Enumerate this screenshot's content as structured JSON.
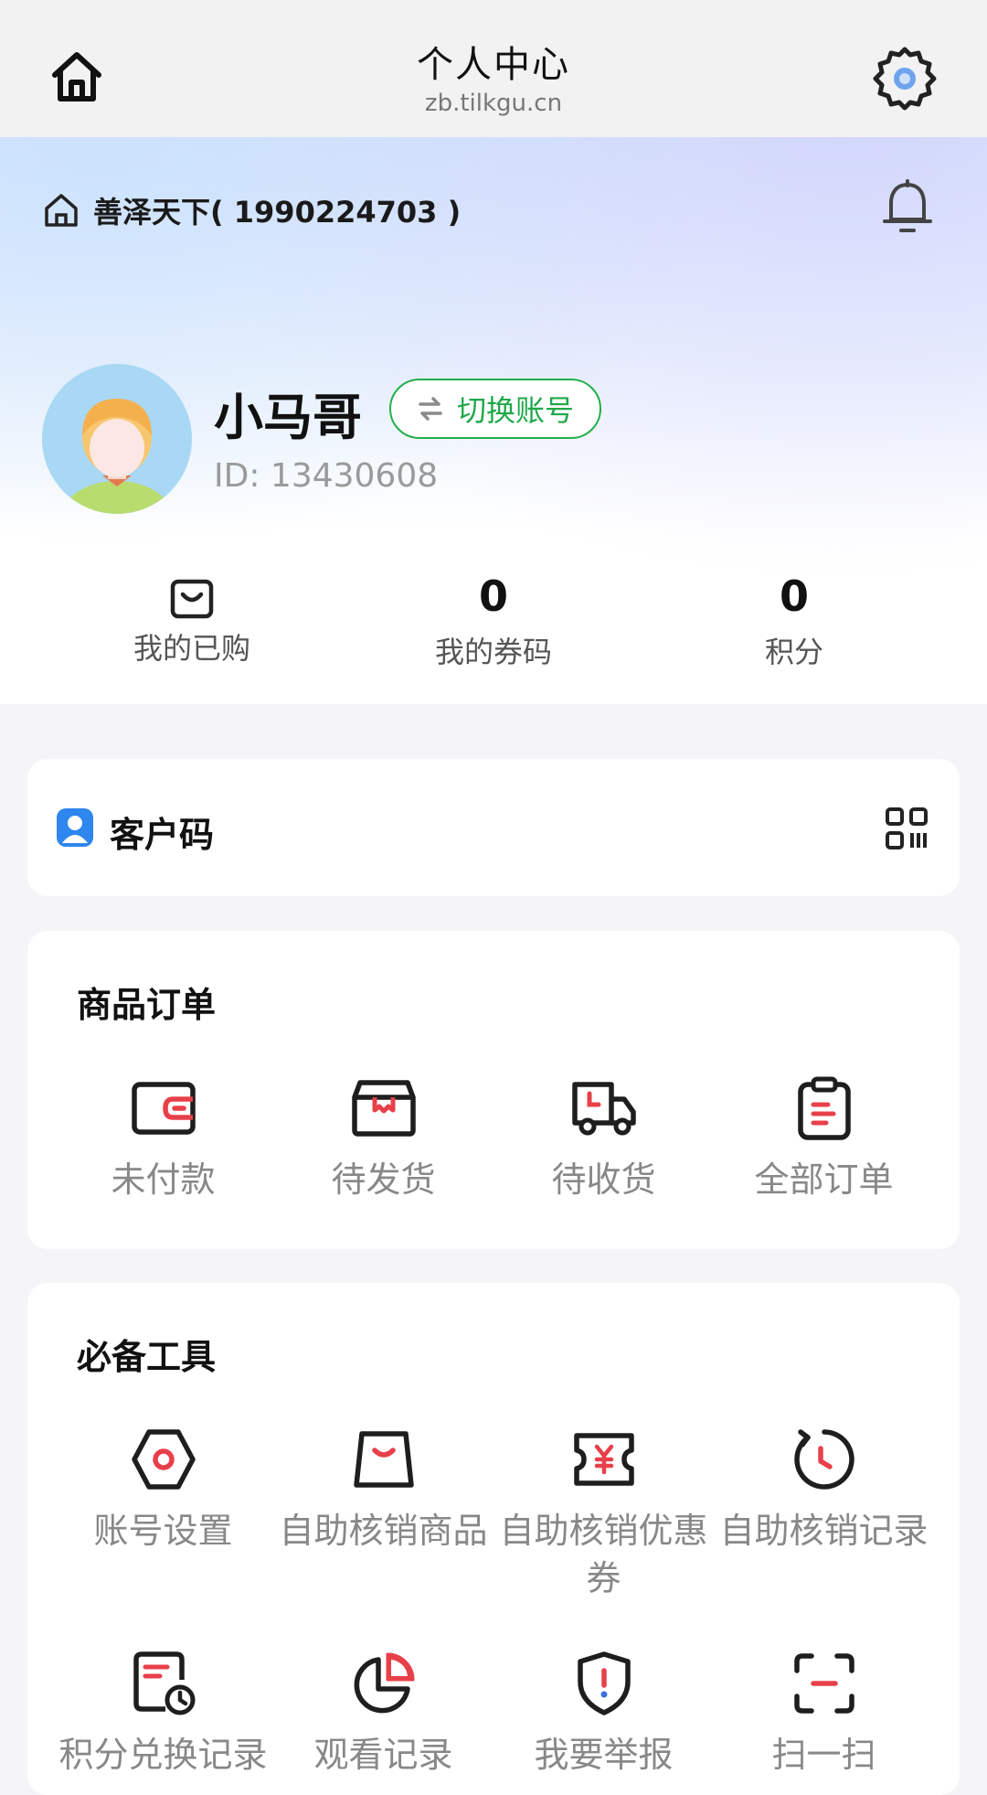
{
  "topbar": {
    "title": "个人中心",
    "url": "zb.tilkgu.cn",
    "home_icon": "home-icon",
    "settings_icon": "gear-icon"
  },
  "shop": {
    "name": "善泽天下( 1990224703 )",
    "icon": "home-outline-icon",
    "bell_icon": "bell-icon"
  },
  "user": {
    "name": "小马哥",
    "switch_label": "切换账号",
    "id_text": "ID: 13430608"
  },
  "stats": [
    {
      "icon": "bag-icon",
      "label": "我的已购"
    },
    {
      "value": "0",
      "label": "我的券码"
    },
    {
      "value": "0",
      "label": "积分"
    }
  ],
  "customer_code": {
    "label": "客户码",
    "icon": "user-badge-icon",
    "qr_icon": "qr-code-icon"
  },
  "orders": {
    "title": "商品订单",
    "items": [
      {
        "label": "未付款",
        "icon": "wallet-icon"
      },
      {
        "label": "待发货",
        "icon": "package-icon"
      },
      {
        "label": "待收货",
        "icon": "truck-icon"
      },
      {
        "label": "全部订单",
        "icon": "clipboard-icon"
      }
    ]
  },
  "tools": {
    "title": "必备工具",
    "items": [
      {
        "label": "账号设置",
        "icon": "hex-settings-icon"
      },
      {
        "label": "自助核销商品",
        "icon": "bag-smile-icon"
      },
      {
        "label": "自助核销优惠券",
        "icon": "coupon-icon"
      },
      {
        "label": "自助核销记录",
        "icon": "history-clock-icon"
      },
      {
        "label": "积分兑换记录",
        "icon": "doc-clock-icon"
      },
      {
        "label": "观看记录",
        "icon": "pie-icon"
      },
      {
        "label": "我要举报",
        "icon": "shield-alert-icon"
      },
      {
        "label": "扫一扫",
        "icon": "scan-icon"
      }
    ]
  },
  "colors": {
    "accent_red": "#e8404a",
    "accent_green": "#1fa84a",
    "icon_dark": "#1e1e1e"
  }
}
